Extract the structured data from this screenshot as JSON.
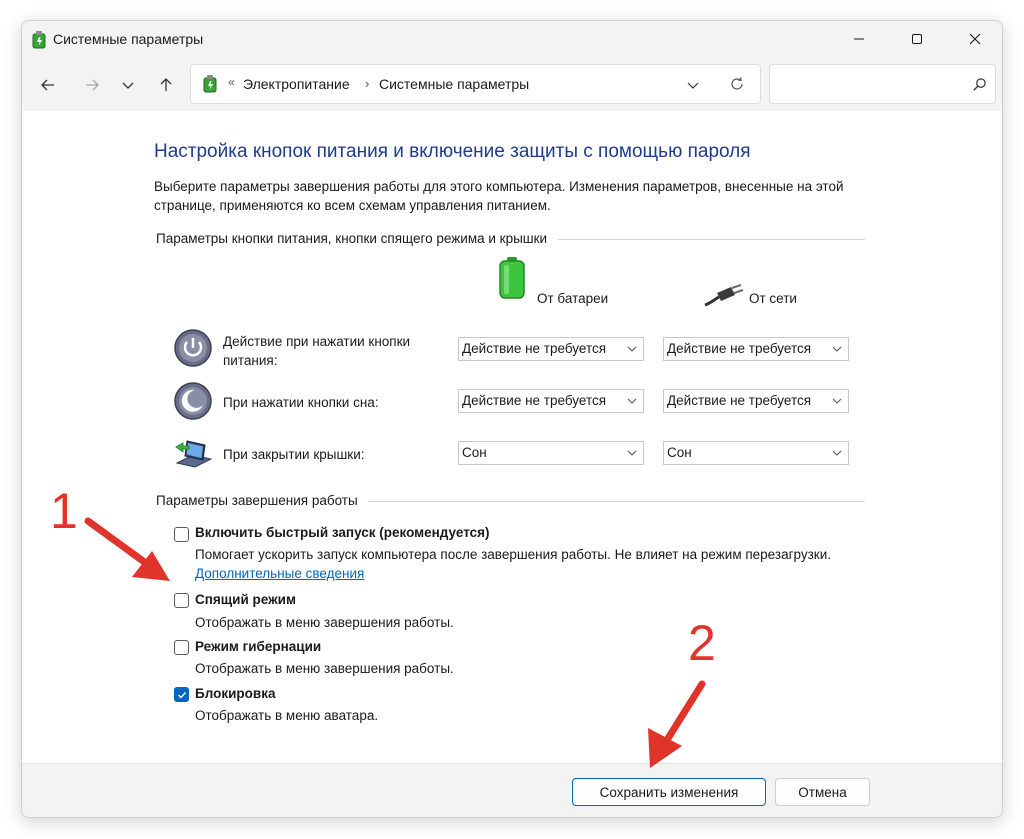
{
  "window": {
    "title": "Системные параметры",
    "controls": [
      "minimize",
      "maximize",
      "close"
    ]
  },
  "nav": {
    "address": {
      "separator": "«",
      "crumbs": [
        "Электропитание",
        "Системные параметры"
      ]
    },
    "search_placeholder": ""
  },
  "page": {
    "title": "Настройка кнопок питания и включение защиты с помощью пароля",
    "description": "Выберите параметры завершения работы для этого компьютера. Изменения параметров, внесенные на этой странице, применяются ко всем схемам управления питанием."
  },
  "power_section": {
    "title": "Параметры кнопки питания, кнопки спящего режима и крышки",
    "columns": {
      "battery": "От батареи",
      "ac": "От сети"
    },
    "rows": [
      {
        "label": "Действие при нажатии кнопки питания:",
        "battery": "Действие не требуется",
        "ac": "Действие не требуется",
        "icon": "power-button-icon"
      },
      {
        "label": "При нажатии кнопки сна:",
        "battery": "Действие не требуется",
        "ac": "Действие не требуется",
        "icon": "sleep-button-icon"
      },
      {
        "label": "При закрытии крышки:",
        "battery": "Сон",
        "ac": "Сон",
        "icon": "laptop-lid-icon"
      }
    ]
  },
  "shutdown_section": {
    "title": "Параметры завершения работы",
    "options": [
      {
        "title": "Включить быстрый запуск (рекомендуется)",
        "desc": "Помогает ускорить запуск компьютера после завершения работы. Не влияет на режим перезагрузки.",
        "link": "Дополнительные сведения",
        "checked": false
      },
      {
        "title": "Спящий режим",
        "desc": "Отображать в меню завершения работы.",
        "checked": false
      },
      {
        "title": "Режим гибернации",
        "desc": "Отображать в меню завершения работы.",
        "checked": false
      },
      {
        "title": "Блокировка",
        "desc": "Отображать в меню аватара.",
        "checked": true
      }
    ]
  },
  "footer": {
    "save_label": "Сохранить изменения",
    "cancel_label": "Отмена"
  },
  "annotations": {
    "step1": "1",
    "step2": "2",
    "color": "#e0342a"
  },
  "colors": {
    "title_blue": "#1e3c8c",
    "accent": "#0067c0"
  }
}
